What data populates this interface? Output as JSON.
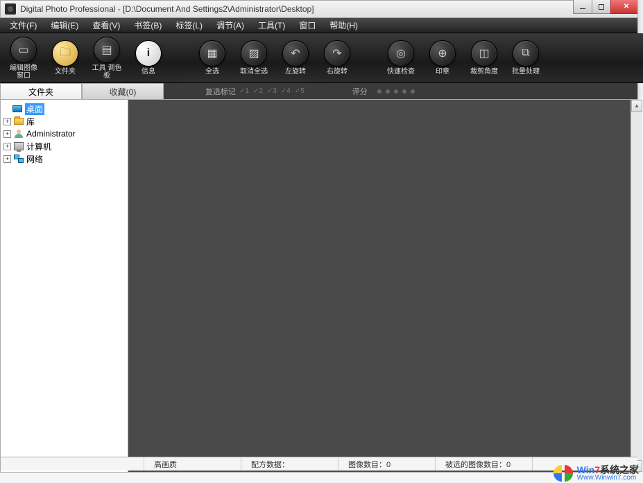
{
  "title": "Digital Photo Professional - [D:\\Document And Settings2\\Administrator\\Desktop]",
  "menu": {
    "file": "文件(F)",
    "edit": "编辑(E)",
    "view": "查看(V)",
    "bookmark": "书签(B)",
    "label": "标签(L)",
    "adjust": "调节(A)",
    "tools": "工具(T)",
    "window": "窗口",
    "help": "帮助(H)"
  },
  "toolbar": {
    "edit_image_window": "编辑图像\n窗口",
    "folder": "文件夹",
    "tool_palette": "工具\n调色板",
    "info": "信息",
    "select_all": "全选",
    "deselect_all": "取消全选",
    "rotate_left": "左旋转",
    "rotate_right": "右旋转",
    "quick_check": "快速检查",
    "stamp": "印章",
    "trim_angle": "裁剪角度",
    "batch": "批量处理"
  },
  "tabs": {
    "folder": "文件夹",
    "favorites_label": "收藏(0)"
  },
  "filterbar": {
    "multi_select_label": "复选标记",
    "marks": [
      "1",
      "2",
      "3",
      "4",
      "5"
    ],
    "rating_label": "评分"
  },
  "tree": {
    "desktop": "桌面",
    "library": "库",
    "administrator": "Administrator",
    "computer": "计算机",
    "network": "网络"
  },
  "status": {
    "quality": "高画质",
    "recipe": "配方数据：",
    "image_count": "图像数目：0",
    "selected_count": "被选的图像数目：0"
  },
  "watermark": {
    "line1_win": "Win",
    "line1_seven": "7",
    "line1_rest": "系统之家",
    "line2": "Www.Winwin7.com"
  }
}
